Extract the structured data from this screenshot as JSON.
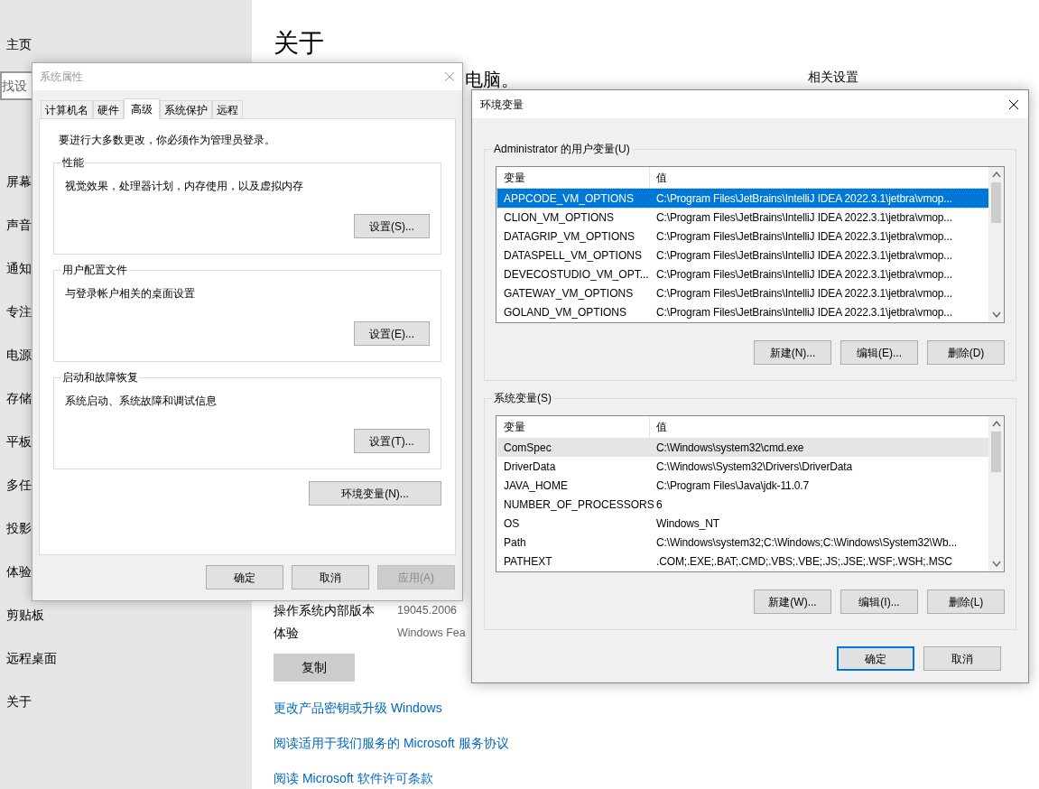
{
  "settings_sidebar": {
    "home": "主页",
    "search": {
      "placeholder": "找设"
    },
    "items": [
      {
        "label": "屏幕"
      },
      {
        "label": "声音"
      },
      {
        "label": "通知"
      },
      {
        "label": "专注"
      },
      {
        "label": "电源"
      },
      {
        "label": "存储"
      },
      {
        "label": "平板"
      },
      {
        "label": "多任"
      },
      {
        "label": "投影"
      },
      {
        "label": "体验"
      },
      {
        "label": "剪贴板"
      },
      {
        "label": "远程桌面"
      },
      {
        "label": "关于"
      }
    ]
  },
  "about_page": {
    "title": "关于",
    "subtitle": "电脑。",
    "related_title": "相关设置",
    "specs": [
      {
        "label": "操作系统内部版本",
        "value": "19045.2006"
      },
      {
        "label": "体验",
        "value": "Windows Fea"
      }
    ],
    "copy_button": "复制",
    "links": [
      "更改产品密钥或升级 Windows",
      "阅读适用于我们服务的 Microsoft 服务协议",
      "阅读 Microsoft 软件许可条款"
    ]
  },
  "system_properties": {
    "title": "系统属性",
    "active": false,
    "tabs": [
      {
        "label": "计算机名",
        "selected": false
      },
      {
        "label": "硬件",
        "selected": false
      },
      {
        "label": "高级",
        "selected": true
      },
      {
        "label": "系统保护",
        "selected": false
      },
      {
        "label": "远程",
        "selected": false
      }
    ],
    "admin_note": "要进行大多数更改，你必须作为管理员登录。",
    "groups": [
      {
        "title": "性能",
        "description": "视觉效果，处理器计划，内存使用，以及虚拟内存",
        "button": "设置(S)..."
      },
      {
        "title": "用户配置文件",
        "description": "与登录帐户相关的桌面设置",
        "button": "设置(E)..."
      },
      {
        "title": "启动和故障恢复",
        "description": "系统启动、系统故障和调试信息",
        "button": "设置(T)..."
      }
    ],
    "env_button": "环境变量(N)...",
    "buttons": [
      {
        "label": "确定",
        "disabled": false
      },
      {
        "label": "取消",
        "disabled": false
      },
      {
        "label": "应用(A)",
        "disabled": true
      }
    ]
  },
  "environment_variables": {
    "title": "环境变量",
    "active": true,
    "lists": [
      {
        "title": "Administrator 的用户变量(U)",
        "focused": true,
        "columns": [
          "变量",
          "值"
        ],
        "rows": [
          {
            "name": "APPCODE_VM_OPTIONS",
            "value": "C:\\Program Files\\JetBrains\\IntelliJ IDEA 2022.3.1\\jetbra\\vmop...",
            "selected": true
          },
          {
            "name": "CLION_VM_OPTIONS",
            "value": "C:\\Program Files\\JetBrains\\IntelliJ IDEA 2022.3.1\\jetbra\\vmop...",
            "selected": false
          },
          {
            "name": "DATAGRIP_VM_OPTIONS",
            "value": "C:\\Program Files\\JetBrains\\IntelliJ IDEA 2022.3.1\\jetbra\\vmop...",
            "selected": false
          },
          {
            "name": "DATASPELL_VM_OPTIONS",
            "value": "C:\\Program Files\\JetBrains\\IntelliJ IDEA 2022.3.1\\jetbra\\vmop...",
            "selected": false
          },
          {
            "name": "DEVECOSTUDIO_VM_OPT...",
            "value": "C:\\Program Files\\JetBrains\\IntelliJ IDEA 2022.3.1\\jetbra\\vmop...",
            "selected": false
          },
          {
            "name": "GATEWAY_VM_OPTIONS",
            "value": "C:\\Program Files\\JetBrains\\IntelliJ IDEA 2022.3.1\\jetbra\\vmop...",
            "selected": false
          },
          {
            "name": "GOLAND_VM_OPTIONS",
            "value": "C:\\Program Files\\JetBrains\\IntelliJ IDEA 2022.3.1\\jetbra\\vmop...",
            "selected": false
          }
        ],
        "buttons": [
          "新建(N)...",
          "编辑(E)...",
          "删除(D)"
        ]
      },
      {
        "title": "系统变量(S)",
        "focused": false,
        "columns": [
          "变量",
          "值"
        ],
        "rows": [
          {
            "name": "ComSpec",
            "value": "C:\\Windows\\system32\\cmd.exe",
            "selected": true
          },
          {
            "name": "DriverData",
            "value": "C:\\Windows\\System32\\Drivers\\DriverData",
            "selected": false
          },
          {
            "name": "JAVA_HOME",
            "value": "C:\\Program Files\\Java\\jdk-11.0.7",
            "selected": false
          },
          {
            "name": "NUMBER_OF_PROCESSORS",
            "value": "6",
            "selected": false
          },
          {
            "name": "OS",
            "value": "Windows_NT",
            "selected": false
          },
          {
            "name": "Path",
            "value": "C:\\Windows\\system32;C:\\Windows;C:\\Windows\\System32\\Wb...",
            "selected": false
          },
          {
            "name": "PATHEXT",
            "value": ".COM;.EXE;.BAT;.CMD;.VBS;.VBE;.JS;.JSE;.WSF;.WSH;.MSC",
            "selected": false
          }
        ],
        "buttons": [
          "新建(W)...",
          "编辑(I)...",
          "删除(L)"
        ]
      }
    ],
    "buttons": [
      {
        "label": "确定",
        "default": true
      },
      {
        "label": "取消",
        "default": false
      }
    ]
  }
}
